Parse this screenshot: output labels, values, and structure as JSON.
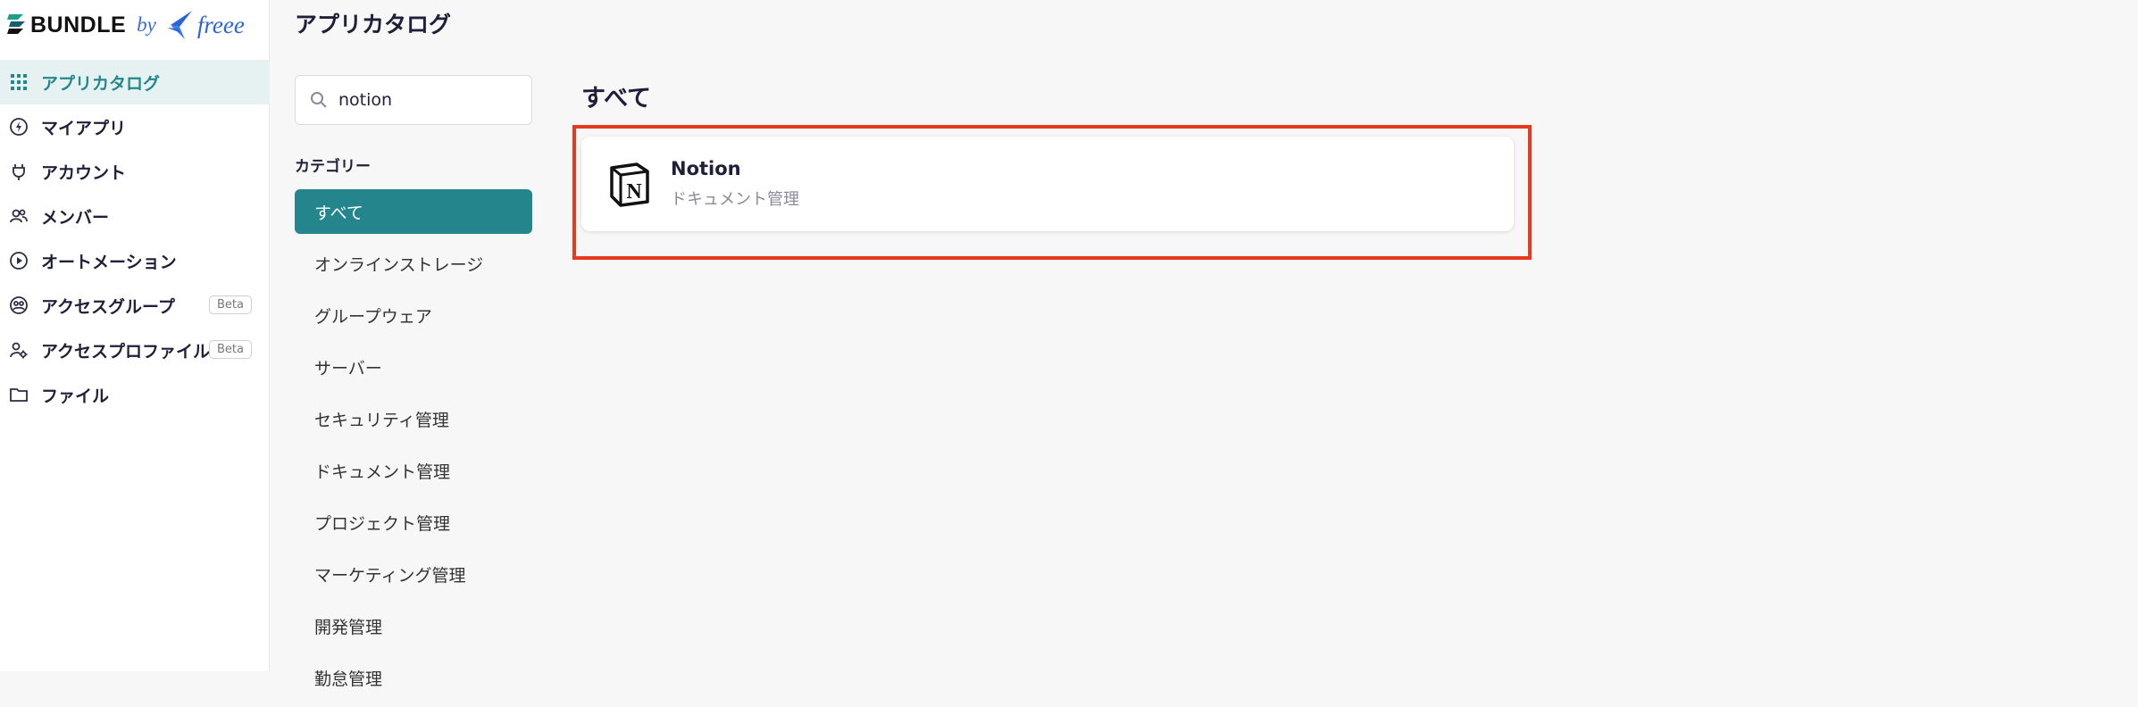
{
  "brand": {
    "name": "BUNDLE",
    "by": "by",
    "partner": "freee"
  },
  "sidebar": {
    "items": [
      {
        "label": "アプリカタログ",
        "icon": "grid-icon",
        "active": true
      },
      {
        "label": "マイアプリ",
        "icon": "bolt-circle-icon"
      },
      {
        "label": "アカウント",
        "icon": "plug-icon"
      },
      {
        "label": "メンバー",
        "icon": "people-icon"
      },
      {
        "label": "オートメーション",
        "icon": "play-circle-icon"
      },
      {
        "label": "アクセスグループ",
        "icon": "group-icon",
        "badge": "Beta"
      },
      {
        "label": "アクセスプロファイル",
        "icon": "user-gear-icon",
        "badge": "Beta"
      },
      {
        "label": "ファイル",
        "icon": "folder-icon"
      }
    ]
  },
  "page": {
    "title": "アプリカタログ"
  },
  "search": {
    "value": "notion",
    "placeholder": ""
  },
  "categories": {
    "heading": "カテゴリー",
    "items": [
      "すべて",
      "オンラインストレージ",
      "グループウェア",
      "サーバー",
      "セキュリティ管理",
      "ドキュメント管理",
      "プロジェクト管理",
      "マーケティング管理",
      "開発管理",
      "勤怠管理"
    ]
  },
  "main": {
    "section_title": "すべて",
    "apps": [
      {
        "name": "Notion",
        "category": "ドキュメント管理"
      }
    ]
  },
  "colors": {
    "accent": "#24868c",
    "highlight": "#e8391f"
  }
}
